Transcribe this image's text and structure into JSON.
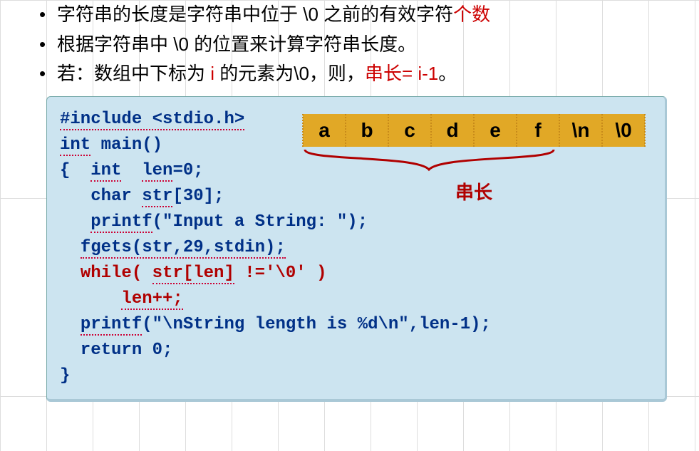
{
  "bullets": {
    "b1_a": "字符串的长度是字符串中位于 \\0 之前的有效字符",
    "b1_b": "个数",
    "b2": "根据字符串中 \\0 的位置来计算字符串长度。",
    "b3_a": "若：数组中下标为 ",
    "b3_b": "i",
    "b3_c": " 的元素为\\0，则，",
    "b3_d": "串长= i-1",
    "b3_e": "。"
  },
  "code": {
    "l1": "#include <stdio.h>",
    "l2a": "int",
    "l2b": " main()",
    "l3a": "{  ",
    "l3b": "int",
    "l3c": "  ",
    "l3d": "len",
    "l3e": "=0;",
    "l4a": "   ",
    "l4b": "char",
    "l4c": " ",
    "l4d": "str",
    "l4e": "[30];",
    "l5a": "   ",
    "l5b": "printf",
    "l5c": "(\"Input a String: \");",
    "l6a": "  ",
    "l6b": "fgets(str,29,stdin);",
    "l7a": "  ",
    "l7b": "while( ",
    "l7c": "str[len]",
    "l7d": " !='\\0' )",
    "l8a": "      ",
    "l8b": "len++;",
    "l9a": "  ",
    "l9b": "printf",
    "l9c": "(\"\\nString length is %d\\n\",len-1);",
    "l10": "  return 0;",
    "l11": "}"
  },
  "cells": {
    "c0": "a",
    "c1": "b",
    "c2": "c",
    "c3": "d",
    "c4": "e",
    "c5": "f",
    "c6": "\\n",
    "c7": "\\0"
  },
  "brace_label": "串长"
}
